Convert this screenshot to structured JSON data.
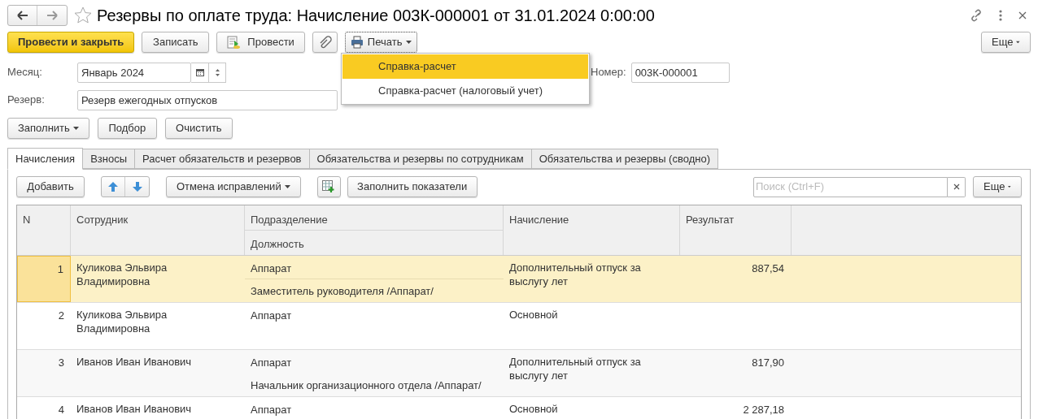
{
  "window": {
    "title": "Резервы по оплате труда: Начисление 003К-000001 от 31.01.2024 0:00:00"
  },
  "toolbar": {
    "post_and_close": "Провести и закрыть",
    "save": "Записать",
    "post": "Провести",
    "print": "Печать",
    "more": "Еще"
  },
  "print_menu": [
    {
      "label": "Справка-расчет",
      "selected": true
    },
    {
      "label": "Справка-расчет (налоговый учет)",
      "selected": false
    }
  ],
  "fields": {
    "month": {
      "label": "Месяц:",
      "value": "Январь 2024"
    },
    "number": {
      "label": "Номер:",
      "value": "003К-000001"
    },
    "reserve": {
      "label": "Резерв:",
      "value": "Резерв ежегодных отпусков"
    }
  },
  "fill_buttons": {
    "fill": "Заполнить",
    "pick": "Подбор",
    "clear": "Очистить"
  },
  "tabs": [
    {
      "label": "Начисления",
      "selected": true
    },
    {
      "label": "Взносы",
      "selected": false
    },
    {
      "label": "Расчет обязательств и резервов",
      "selected": false
    },
    {
      "label": "Обязательства и резервы по сотрудникам",
      "selected": false
    },
    {
      "label": "Обязательства и резервы (сводно)",
      "selected": false
    }
  ],
  "table_toolbar": {
    "add": "Добавить",
    "undo_corrections": "Отмена исправлений",
    "fill_indicators": "Заполнить показатели",
    "search": {
      "placeholder": "Поиск (Ctrl+F)"
    },
    "more": "Еще"
  },
  "table": {
    "columns": {
      "n": "N",
      "employee": "Сотрудник",
      "department": "Подразделение",
      "position": "Должность",
      "accrual": "Начисление",
      "result": "Результат"
    },
    "rows": [
      {
        "n": "1",
        "employee": "Куликова Эльвира Владимировна",
        "department": "Аппарат",
        "position": "Заместитель руководителя /Аппарат/",
        "accrual": "Дополнительный отпуск за выслугу лет",
        "result": "887,54",
        "selected": true
      },
      {
        "n": "2",
        "employee": "Куликова Эльвира Владимировна",
        "department": "Аппарат",
        "accrual": "Основной",
        "selected": false
      },
      {
        "n": "3",
        "employee": "Иванов Иван Иванович",
        "department": "Аппарат",
        "position": "Начальник организационного отдела /Аппарат/",
        "accrual": "Дополнительный отпуск за выслугу лет",
        "result": "817,90",
        "selected": false
      },
      {
        "n": "4",
        "employee": "Иванов Иван Иванович",
        "department": "Аппарат",
        "accrual": "Основной",
        "result": "2 287,18",
        "selected": false
      }
    ]
  }
}
